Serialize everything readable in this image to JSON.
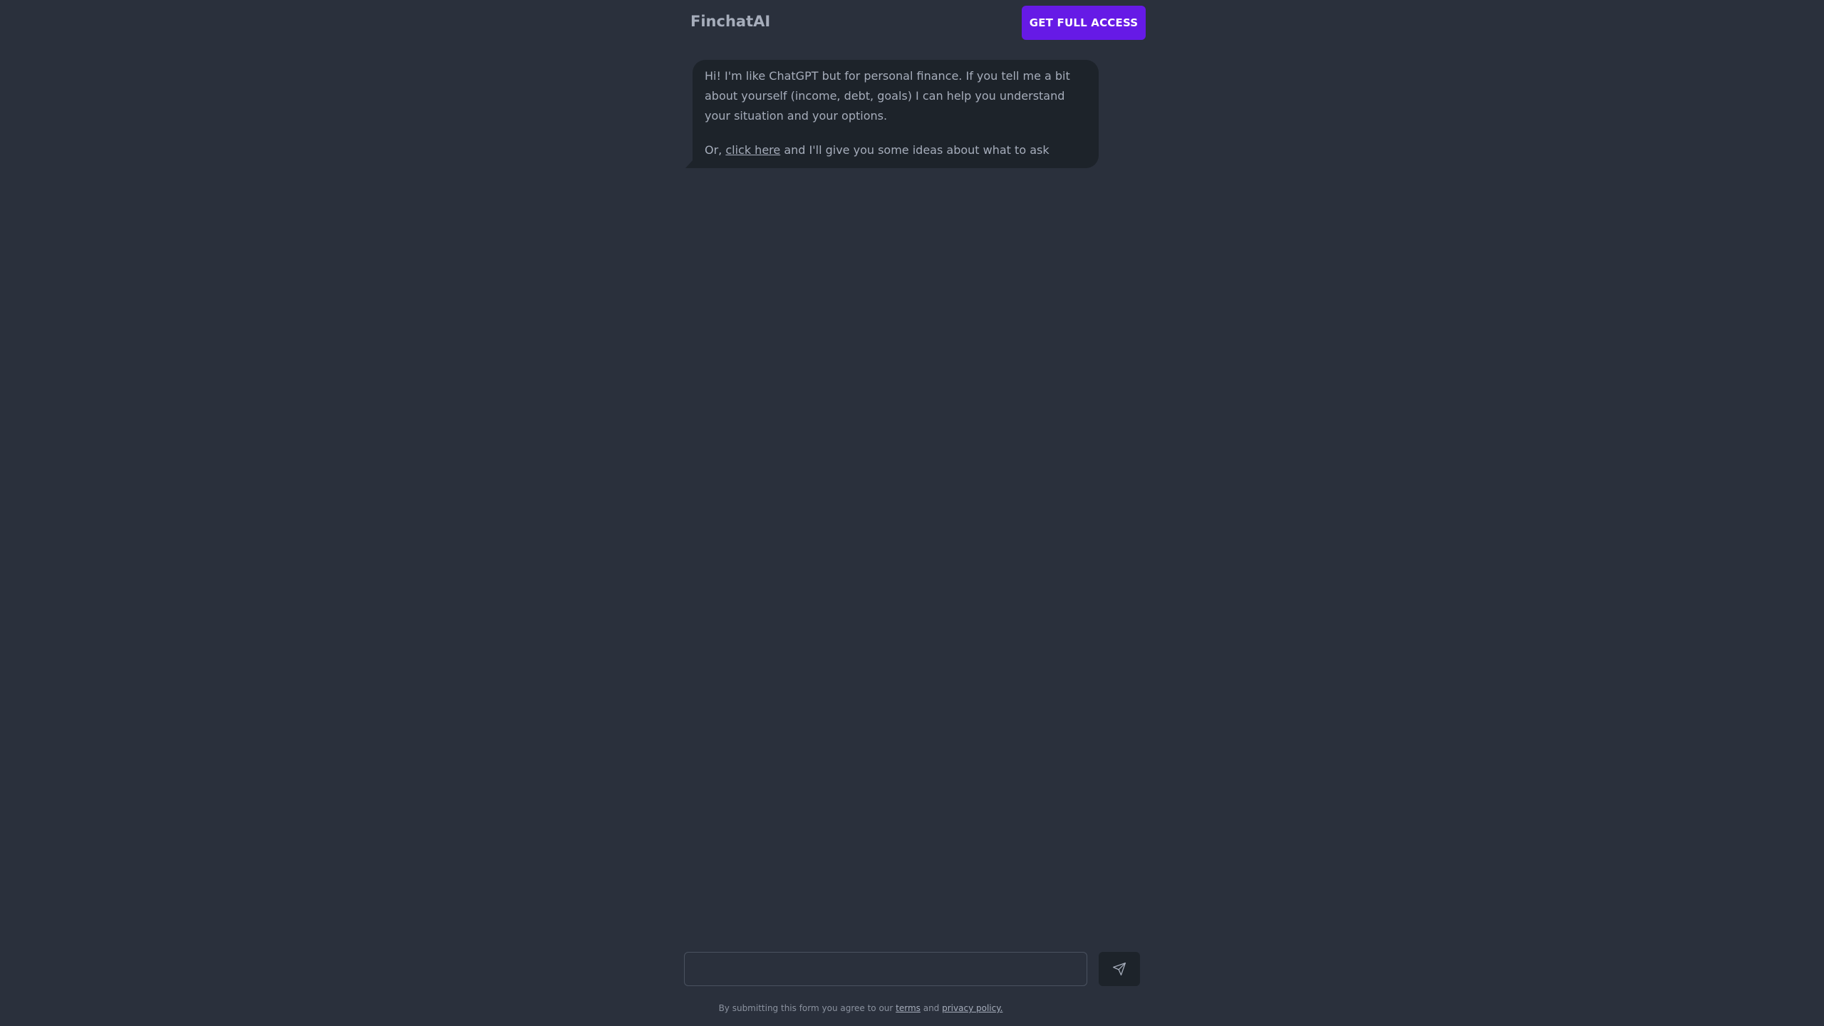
{
  "header": {
    "brand": "FinchatAI",
    "cta_label": "GET FULL ACCESS"
  },
  "chat": {
    "messages": [
      {
        "role": "assistant",
        "intro": "Hi! I'm like ChatGPT but for personal finance. If you tell me a bit about yourself (income, debt, goals) I can help you understand your situation and your options.",
        "prompt_prefix": "Or, ",
        "prompt_link": "click here",
        "prompt_suffix": " and I'll give you some ideas about what to ask"
      }
    ]
  },
  "composer": {
    "input_value": "",
    "send_icon": "send-paper-plane-icon"
  },
  "footer": {
    "prefix": "By submitting this form you agree to our ",
    "terms_link": "terms",
    "and_text": " and ",
    "privacy_link": "privacy policy."
  },
  "colors": {
    "background": "#2a303c",
    "bubble": "#1d232a",
    "accent": "#661ae6",
    "text": "#a6adbb"
  }
}
